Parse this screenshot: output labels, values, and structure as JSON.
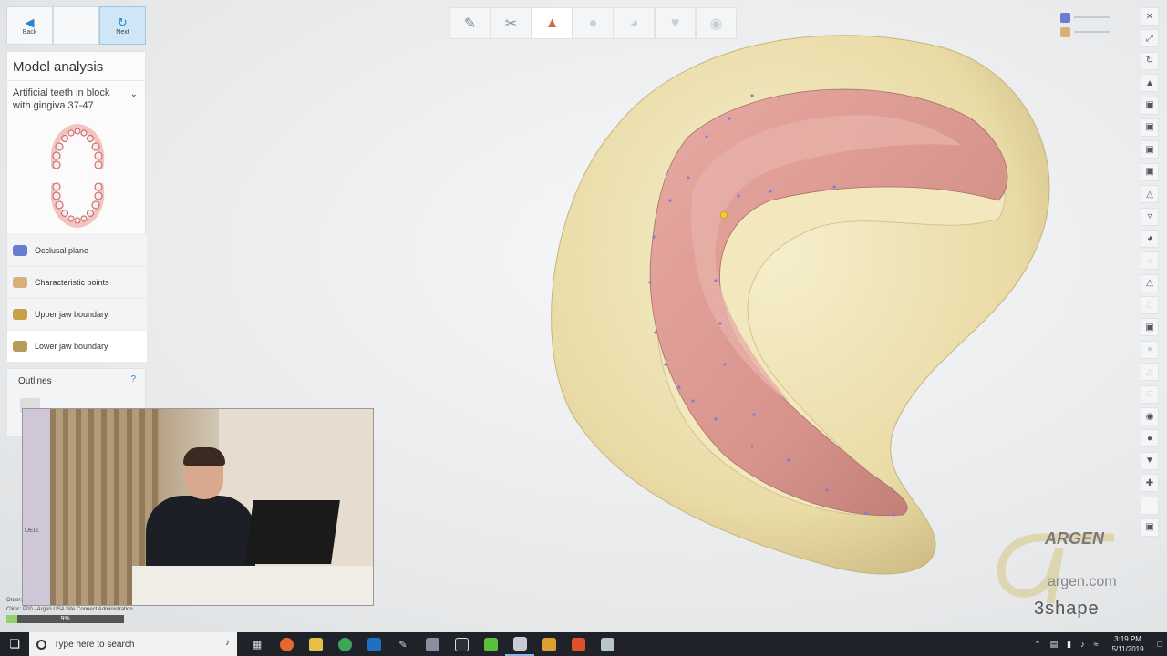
{
  "nav": {
    "back_label": "Back",
    "next_label": "Next"
  },
  "panel": {
    "title": "Model analysis",
    "case_select": "Artificial teeth in block with gingiva 37-47",
    "steps": [
      {
        "label": "Occlusal plane",
        "icon": "occlusal-plane-icon",
        "color": "#6b7bd0"
      },
      {
        "label": "Characteristic points",
        "icon": "characteristic-points-icon",
        "color": "#d8b07a"
      },
      {
        "label": "Upper jaw boundary",
        "icon": "upper-jaw-icon",
        "color": "#c9a04a"
      },
      {
        "label": "Lower jaw boundary",
        "icon": "lower-jaw-icon",
        "color": "#b89a5a"
      }
    ]
  },
  "outlines": {
    "title": "Outlines",
    "help": "?"
  },
  "status": {
    "order": "Order:",
    "clinic": "Clinic:     P00 - Argen USA Site Connect Administration",
    "progress_label": "9%",
    "progress": 0.09
  },
  "video": {
    "poster_text": "DED."
  },
  "watermark": {
    "brand": "ARGEN",
    "url": "argen.com",
    "shape": "3shape"
  },
  "taskbar": {
    "search_placeholder": "Type here to search",
    "time": "3:19 PM",
    "date": "5/11/2019"
  },
  "colors": {
    "accent": "#2a86d1",
    "model_base": "#efe3b4",
    "gingiva": "#d89a93",
    "progress_fill": "#8fd16a"
  }
}
